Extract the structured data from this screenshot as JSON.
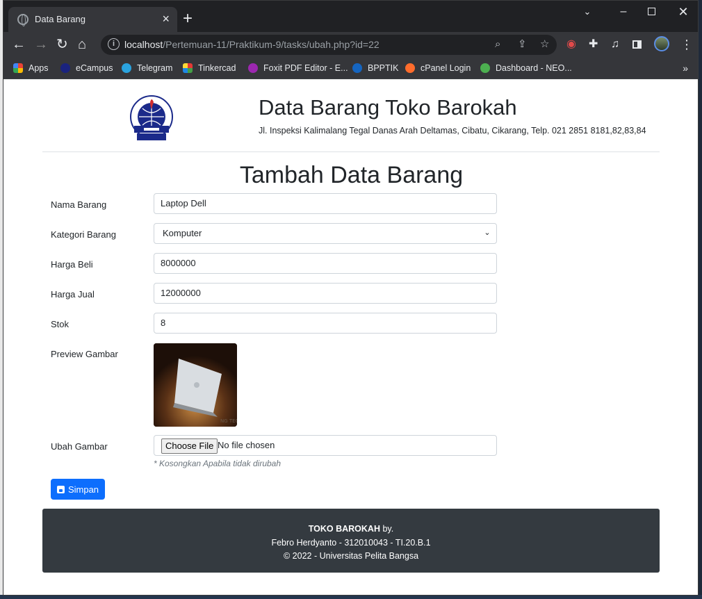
{
  "browser": {
    "tab_title": "Data Barang",
    "url_host": "localhost",
    "url_path": "/Pertemuan-11/Praktikum-9/tasks/ubah.php?id=22",
    "bookmarks": [
      {
        "label": "Apps",
        "color": "#ea4335"
      },
      {
        "label": "eCampus",
        "color": "#1a237e"
      },
      {
        "label": "Telegram",
        "color": "#2aa3df"
      },
      {
        "label": "Tinkercad",
        "color": "#1e88e5"
      },
      {
        "label": "Foxit PDF Editor - E...",
        "color": "#9c27b0"
      },
      {
        "label": "BPPTIK",
        "color": "#1565c0"
      },
      {
        "label": "cPanel Login",
        "color": "#ff6c2c"
      },
      {
        "label": "Dashboard - NEO...",
        "color": "#4caf50"
      }
    ]
  },
  "header": {
    "title": "Data Barang Toko Barokah",
    "address": "Jl. Inspeksi Kalimalang Tegal Danas Arah Deltamas, Cibatu, Cikarang, Telp. 021 2851 8181,82,83,84"
  },
  "form": {
    "title": "Tambah Data Barang",
    "nama_label": "Nama Barang",
    "nama_value": "Laptop Dell",
    "kategori_label": "Kategori Barang",
    "kategori_value": "Komputer",
    "harga_beli_label": "Harga Beli",
    "harga_beli_value": "8000000",
    "harga_jual_label": "Harga Jual",
    "harga_jual_value": "12000000",
    "stok_label": "Stok",
    "stok_value": "8",
    "preview_label": "Preview Gambar",
    "ubah_label": "Ubah Gambar",
    "file_button": "Choose File",
    "file_status": "No file chosen",
    "hint": "* Kosongkan Apabila tidak dirubah",
    "submit": "Simpan"
  },
  "footer": {
    "brand": "TOKO BAROKAH",
    "by": " by.",
    "author": "Febro Herdyanto - 312010043 - TI.20.B.1",
    "copyright": "© 2022 - Universitas Pelita Bangsa"
  },
  "colors": {
    "primary": "#0d6efd",
    "footer_bg": "#343a40"
  }
}
